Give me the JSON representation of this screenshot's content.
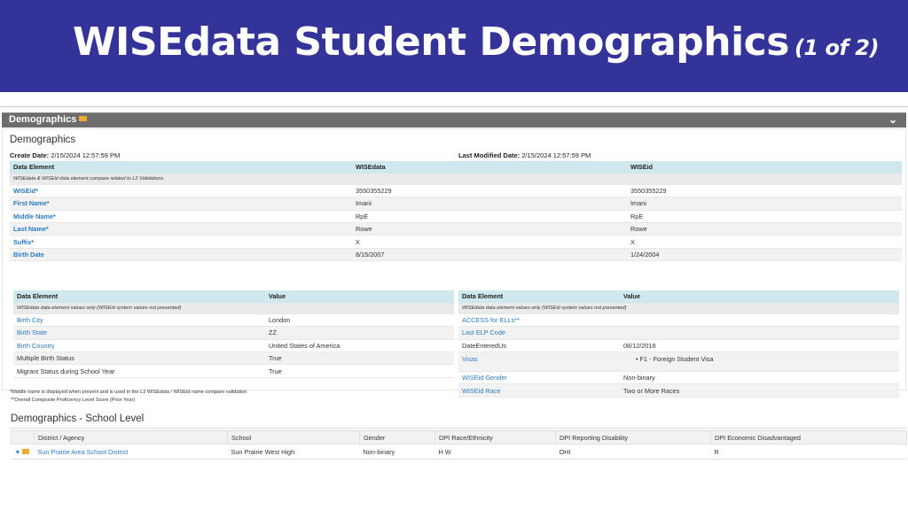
{
  "banner": {
    "title": "WISEdata Student Demographics",
    "subtitle": "(1 of 2)"
  },
  "panel": {
    "title": "Demographics"
  },
  "demographics": {
    "title": "Demographics",
    "create_label": "Create Date:",
    "create_value": "2/15/2024 12:57:59 PM",
    "modified_label": "Last Modified Date:",
    "modified_value": "2/15/2024 12:57:59 PM"
  },
  "main_table": {
    "headers": [
      "Data Element",
      "WISEdata",
      "WISEid"
    ],
    "note": "WISEdata & WISEid data element compare related to L2 Validations",
    "rows": [
      [
        "WISEid*",
        "3550355229",
        "3550355229"
      ],
      [
        "First Name*",
        "Imani",
        "Imani"
      ],
      [
        "Middle Name*",
        "RpE",
        "RpE"
      ],
      [
        "Last Name*",
        "Rowe",
        "Rowe"
      ],
      [
        "Suffix*",
        "X",
        "X"
      ],
      [
        "Birth Date",
        "8/15/2007",
        "1/24/2004"
      ]
    ]
  },
  "left_table": {
    "headers": [
      "Data Element",
      "Value"
    ],
    "note": "WISEdata data element values only (WISEid system values not presented)",
    "rows": [
      [
        "Birth City",
        "London"
      ],
      [
        "Birth State",
        "ZZ"
      ],
      [
        "Birth Country",
        "United States of America"
      ],
      [
        "Multiple Birth Status",
        "True"
      ],
      [
        "Migrant Status during School Year",
        "True"
      ]
    ]
  },
  "right_table": {
    "headers": [
      "Data Element",
      "Value"
    ],
    "note": "WISEdata data element values only (WISEid system values not presented)",
    "rows": [
      [
        "ACCESS for ELLs**",
        ""
      ],
      [
        "Last ELP Code",
        ""
      ],
      [
        "DateEnteredUs",
        "08/12/2018"
      ],
      [
        "Visas",
        "•  F1 - Foreign Student Visa"
      ],
      [
        "WISEid Gender",
        "Non-binary"
      ],
      [
        "WISEid Race",
        "Two or More Races"
      ]
    ]
  },
  "footnotes": [
    "*Middle name is displayed when present and is used in the L2 WISEdata / WISEid name compare validation",
    "**Overall Composite Proficiency Level Score (Prior Year)"
  ],
  "school": {
    "title": "Demographics - School Level",
    "headers": [
      "District / Agency",
      "School",
      "Gender",
      "DPI Race/Ethnicity",
      "DPI Reporting Disability",
      "DPI Economic Disadvantaged"
    ],
    "row": [
      "Sun Prairie Area School District",
      "Sun Prairie West High",
      "Non-binary",
      "H W",
      "OHI",
      "R"
    ]
  },
  "colors": {
    "banner": "#333399",
    "header_bar": "#6d6d6d",
    "table_header": "#cfe8ee",
    "link": "#2a7ac4",
    "mail": "#f0a830"
  },
  "icons": [
    "mail-icon",
    "chevron-down-icon",
    "expand-triangle-icon"
  ]
}
